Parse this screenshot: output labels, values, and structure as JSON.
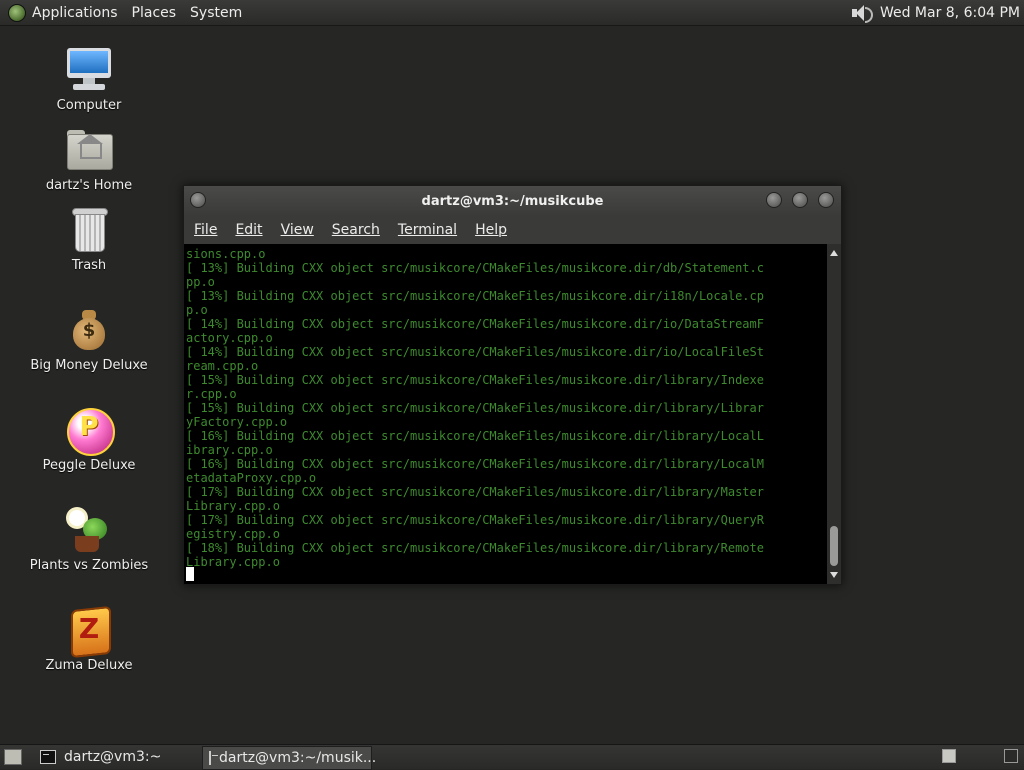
{
  "top_panel": {
    "menus": [
      "Applications",
      "Places",
      "System"
    ],
    "clock": "Wed Mar  8,  6:04 PM"
  },
  "desktop_icons": [
    {
      "label": "Computer",
      "icon": "computer-icon"
    },
    {
      "label": "dartz's Home",
      "icon": "home-folder-icon"
    },
    {
      "label": "Trash",
      "icon": "trash-icon"
    },
    {
      "label": "Big Money Deluxe",
      "icon": "big-money-icon"
    },
    {
      "label": "Peggle Deluxe",
      "icon": "peggle-icon"
    },
    {
      "label": "Plants vs Zombies",
      "icon": "plants-vs-zombies-icon"
    },
    {
      "label": "Zuma Deluxe",
      "icon": "zuma-icon"
    }
  ],
  "terminal": {
    "title": "dartz@vm3:~/musikcube",
    "menu": [
      "File",
      "Edit",
      "View",
      "Search",
      "Terminal",
      "Help"
    ],
    "lines": [
      "sions.cpp.o",
      "[ 13%] Building CXX object src/musikcore/CMakeFiles/musikcore.dir/db/Statement.c",
      "pp.o",
      "[ 13%] Building CXX object src/musikcore/CMakeFiles/musikcore.dir/i18n/Locale.cp",
      "p.o",
      "[ 14%] Building CXX object src/musikcore/CMakeFiles/musikcore.dir/io/DataStreamF",
      "actory.cpp.o",
      "[ 14%] Building CXX object src/musikcore/CMakeFiles/musikcore.dir/io/LocalFileSt",
      "ream.cpp.o",
      "[ 15%] Building CXX object src/musikcore/CMakeFiles/musikcore.dir/library/Indexe",
      "r.cpp.o",
      "[ 15%] Building CXX object src/musikcore/CMakeFiles/musikcore.dir/library/Librar",
      "yFactory.cpp.o",
      "[ 16%] Building CXX object src/musikcore/CMakeFiles/musikcore.dir/library/LocalL",
      "ibrary.cpp.o",
      "[ 16%] Building CXX object src/musikcore/CMakeFiles/musikcore.dir/library/LocalM",
      "etadataProxy.cpp.o",
      "[ 17%] Building CXX object src/musikcore/CMakeFiles/musikcore.dir/library/Master",
      "Library.cpp.o",
      "[ 17%] Building CXX object src/musikcore/CMakeFiles/musikcore.dir/library/QueryR",
      "egistry.cpp.o",
      "[ 18%] Building CXX object src/musikcore/CMakeFiles/musikcore.dir/library/Remote",
      "Library.cpp.o"
    ]
  },
  "taskbar": {
    "tasks": [
      {
        "label": "dartz@vm3:~",
        "active": false
      },
      {
        "label": "dartz@vm3:~/musik...",
        "active": true
      }
    ]
  },
  "colors": {
    "desktop_bg": "#262724",
    "terminal_fg": "#3e8a2f",
    "terminal_bg": "#000000"
  }
}
